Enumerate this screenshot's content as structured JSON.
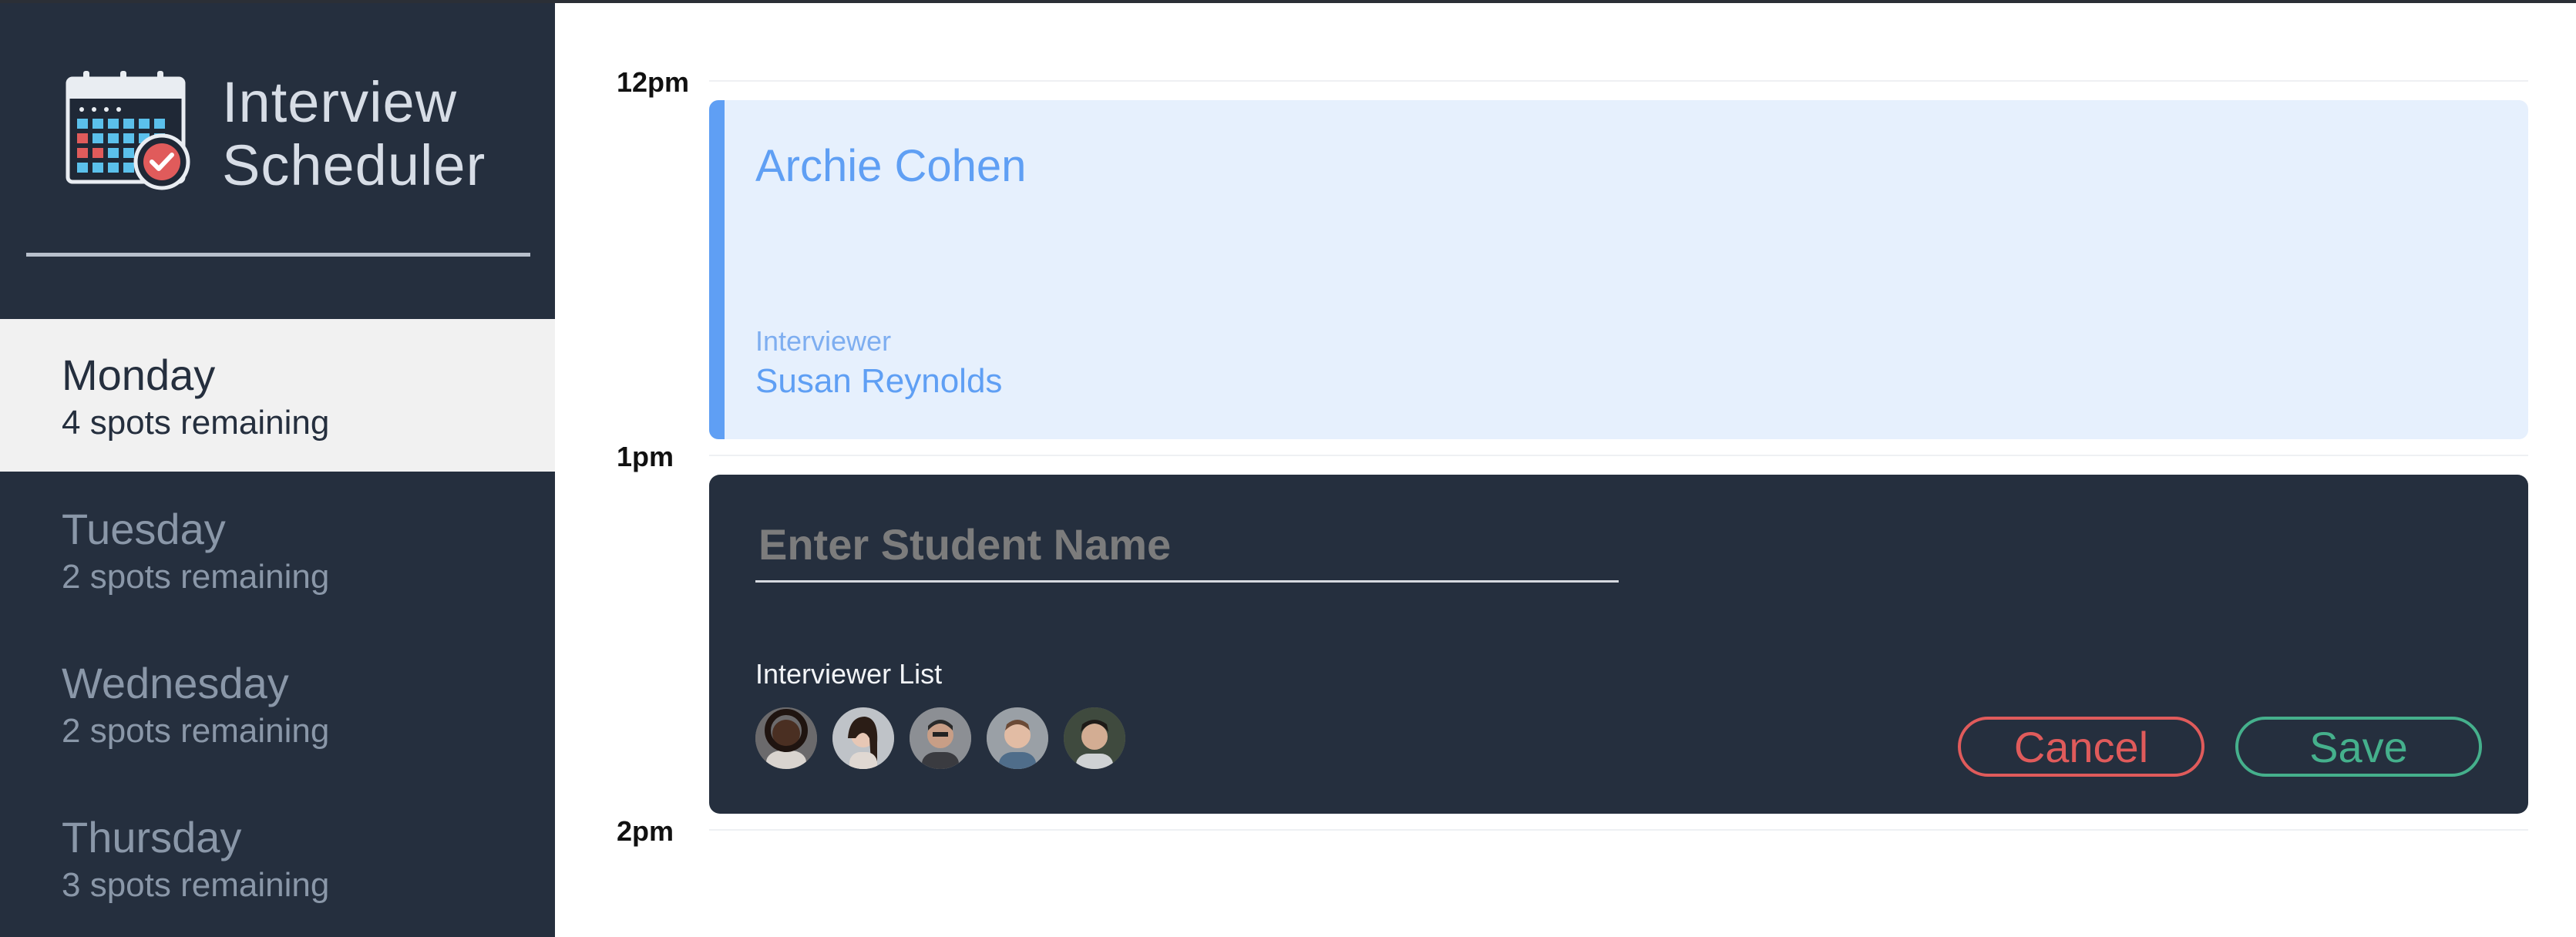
{
  "app": {
    "title_line1": "Interview",
    "title_line2": "Scheduler",
    "logo_icon": "calendar-check-icon"
  },
  "sidebar": {
    "days": [
      {
        "name": "Monday",
        "spots": "4 spots remaining",
        "selected": true
      },
      {
        "name": "Tuesday",
        "spots": "2 spots remaining",
        "selected": false
      },
      {
        "name": "Wednesday",
        "spots": "2 spots remaining",
        "selected": false
      },
      {
        "name": "Thursday",
        "spots": "3 spots remaining",
        "selected": false
      }
    ]
  },
  "schedule": {
    "times": [
      "12pm",
      "1pm",
      "2pm"
    ],
    "appointment": {
      "student": "Archie Cohen",
      "interviewer_label": "Interviewer",
      "interviewer": "Susan Reynolds"
    },
    "form": {
      "student_value": "",
      "student_placeholder": "Enter Student Name",
      "interviewer_list_label": "Interviewer List",
      "avatar_count": 5,
      "cancel_label": "Cancel",
      "save_label": "Save"
    }
  },
  "colors": {
    "sidebar_bg": "#252f3e",
    "selected_day_bg": "#f1f1f1",
    "appointment_bg": "#e6f0fd",
    "appointment_accent": "#5f9ff4",
    "cancel": "#e05b5b",
    "save": "#45b08c"
  }
}
